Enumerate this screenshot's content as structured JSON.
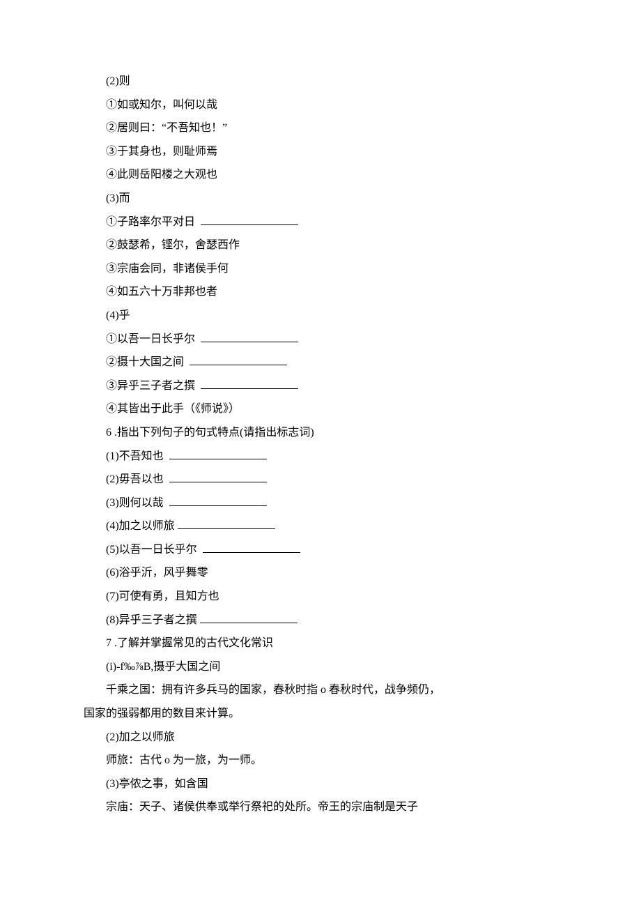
{
  "lines": [
    {
      "text": "(2)则",
      "blank": false,
      "indent": true
    },
    {
      "text": "①如或知尔，叫何以哉",
      "blank": false,
      "indent": true
    },
    {
      "text": "②居则曰：“不吾知也！”",
      "blank": false,
      "indent": true
    },
    {
      "text": "③于其身也，则耻师焉",
      "blank": false,
      "indent": true
    },
    {
      "text": "④此则岳阳楼之大观也",
      "blank": false,
      "indent": true
    },
    {
      "text": "(3)而",
      "blank": false,
      "indent": true
    },
    {
      "text": "①子路率尔平对日 ",
      "blank": true,
      "indent": true
    },
    {
      "text": "②鼓瑟希，铿尔，舍瑟西作",
      "blank": false,
      "indent": true
    },
    {
      "text": "③宗庙会同，非诸侯手何",
      "blank": false,
      "indent": true
    },
    {
      "text": "④如五六十万非邦也者",
      "blank": false,
      "indent": true
    },
    {
      "text": "(4)乎",
      "blank": false,
      "indent": true
    },
    {
      "text": "①以吾一日长乎尔 ",
      "blank": true,
      "indent": true
    },
    {
      "text": "②摄十大国之间 ",
      "blank": true,
      "indent": true
    },
    {
      "text": "③异乎三子者之撰 ",
      "blank": true,
      "indent": true
    },
    {
      "text": "④其皆出于此手（《师说》）",
      "blank": false,
      "indent": true
    },
    {
      "text": "6 .指出下列句子的句式特点(请指出标志词)",
      "blank": false,
      "indent": true
    },
    {
      "text": "(1)不吾知也 ",
      "blank": true,
      "indent": true
    },
    {
      "text": "(2)毋吾以也 ",
      "blank": true,
      "indent": true
    },
    {
      "text": "(3)则何以哉 ",
      "blank": true,
      "indent": true
    },
    {
      "text": "(4)加之以师旅",
      "blank": true,
      "indent": true
    },
    {
      "text": "(5)以吾一日长乎尔 ",
      "blank": true,
      "indent": true
    },
    {
      "text": "(6)浴乎沂，风乎舞零",
      "blank": false,
      "indent": true
    },
    {
      "text": "(7)可使有勇，且知方也",
      "blank": false,
      "indent": true
    },
    {
      "text": "(8)异乎三子者之撰",
      "blank": true,
      "indent": true
    },
    {
      "text": "7 .了解并掌握常见的古代文化常识",
      "blank": false,
      "indent": true
    },
    {
      "text": "(i)-f‰⅞B,摄乎大国之间",
      "blank": false,
      "indent": true
    },
    {
      "text": "千乘之国：拥有许多兵马的国家，春秋时指 o 春秋时代，战争频仍，",
      "blank": false,
      "indent": true
    },
    {
      "text": "国家的强弱都用的数目来计算。",
      "blank": false,
      "indent": false
    },
    {
      "text": "(2)加之以师旅",
      "blank": false,
      "indent": true
    },
    {
      "text": "师旅：古代 o 为一旅，为一师。",
      "blank": false,
      "indent": true
    },
    {
      "text": "(3)亭侬之事，如含国",
      "blank": false,
      "indent": true
    },
    {
      "text": "宗庙：天子、诸侯供奉或举行祭祀的处所。帝王的宗庙制是天子",
      "blank": false,
      "indent": true
    }
  ]
}
